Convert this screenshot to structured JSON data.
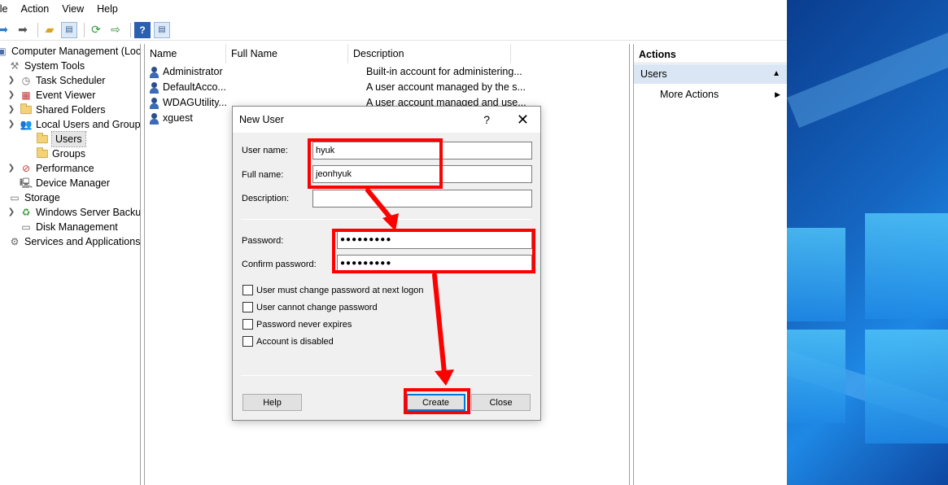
{
  "menu": [
    "ile",
    "Action",
    "View",
    "Help"
  ],
  "tree": {
    "root": "Computer Management (Local",
    "system_tools": "System Tools",
    "task_scheduler": "Task Scheduler",
    "event_viewer": "Event Viewer",
    "shared_folders": "Shared Folders",
    "local_users_groups": "Local Users and Groups",
    "users": "Users",
    "groups": "Groups",
    "performance": "Performance",
    "device_manager": "Device Manager",
    "storage": "Storage",
    "windows_server_backup": "Windows Server Backup",
    "disk_management": "Disk Management",
    "services_applications": "Services and Applications"
  },
  "list": {
    "columns": [
      "Name",
      "Full Name",
      "Description"
    ],
    "rows": [
      {
        "name": "Administrator",
        "full_name": "",
        "description": "Built-in account for administering..."
      },
      {
        "name": "DefaultAcco...",
        "full_name": "",
        "description": "A user account managed by the s..."
      },
      {
        "name": "WDAGUtility...",
        "full_name": "",
        "description": "A user account managed and use..."
      },
      {
        "name": "xguest",
        "full_name": "",
        "description": ""
      }
    ]
  },
  "actions": {
    "title": "Actions",
    "group": "Users",
    "more": "More Actions"
  },
  "dialog": {
    "title": "New User",
    "help_glyph": "?",
    "close_glyph": "✕",
    "username_label": "User name:",
    "username_value": "hyuk",
    "fullname_label": "Full name:",
    "fullname_value": "jeonhyuk",
    "description_label": "Description:",
    "description_value": "",
    "password_label": "Password:",
    "password_value": "●●●●●●●●●",
    "confirm_label": "Confirm password:",
    "confirm_value": "●●●●●●●●●",
    "checks": [
      "User must change password at next logon",
      "User cannot change password",
      "Password never expires",
      "Account is disabled"
    ],
    "help_button": "Help",
    "create_button": "Create",
    "close_button": "Close"
  },
  "colors": {
    "annotation": "#ff0000",
    "selection": "#dae6f3",
    "wallpaper": "#1565c0"
  }
}
